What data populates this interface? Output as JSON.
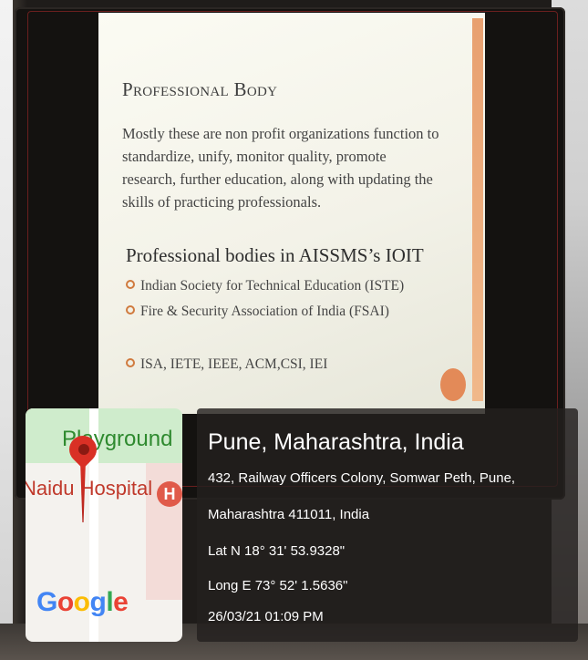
{
  "slide": {
    "heading": "Professional Body",
    "paragraph": "Mostly these are non profit organizations function to standardize, unify, monitor quality, promote research, further education, along with updating the skills of practicing professionals.",
    "subheading": "Professional bodies in AISSMS’s IOIT",
    "bullets": [
      "Indian Society for Technical Education (ISTE)",
      "Fire & Security Association of India (FSAI)",
      "ISA, IETE, IEEE, ACM,CSI, IEI"
    ],
    "accent_color": "#e38a58"
  },
  "map": {
    "label_playground": "Playground",
    "label_hospital": "Naidu Hospital",
    "hospital_icon": "H",
    "brand": "Google",
    "icons": [
      "location-pin-icon",
      "hospital-icon"
    ]
  },
  "location": {
    "city": "Pune, Maharashtra, India",
    "address_line1": "432, Railway Officers Colony, Somwar Peth, Pune,",
    "address_line2": "Maharashtra 411011, India",
    "lat": "Lat N 18° 31' 53.9328\"",
    "long": "Long E 73° 52' 1.5636\"",
    "datetime": "26/03/21 01:09 PM"
  }
}
